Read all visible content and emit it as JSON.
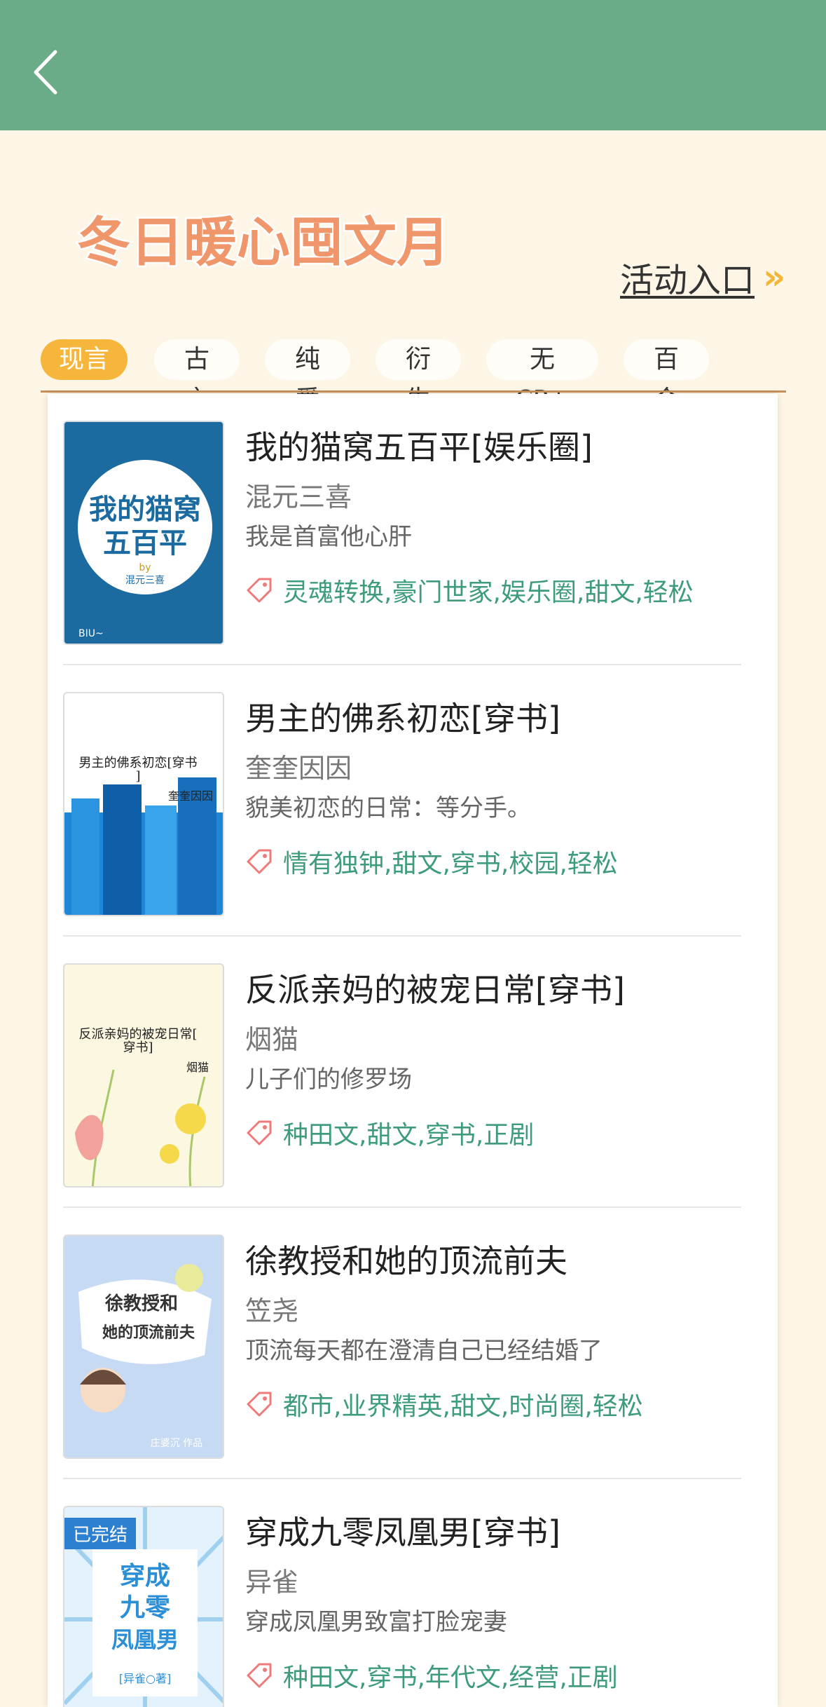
{
  "header": {
    "title": ""
  },
  "banner": {
    "text": "冬日暖心囤文月"
  },
  "entry": {
    "label": "活动入口",
    "chevron": "»"
  },
  "tabs": [
    {
      "label": "现言",
      "active": true
    },
    {
      "label": "古言",
      "active": false
    },
    {
      "label": "纯爱",
      "active": false
    },
    {
      "label": "衍生",
      "active": false
    },
    {
      "label": "无CP+",
      "active": false
    },
    {
      "label": "百合",
      "active": false
    }
  ],
  "books": [
    {
      "title": "我的猫窝五百平[娱乐圈]",
      "author": "混元三喜",
      "desc": "我是首富他心肝",
      "tags": "灵魂转换,豪门世家,娱乐圈,甜文,轻松",
      "cover": {
        "line1": "我的猫窝",
        "line2": "五百平",
        "by": "by",
        "author": "混元三喜",
        "brand": "BIU~"
      }
    },
    {
      "title": "男主的佛系初恋[穿书]",
      "author": "奎奎因因",
      "desc": "貌美初恋的日常：等分手。",
      "tags": "情有独钟,甜文,穿书,校园,轻松",
      "cover": {
        "line1": "男主的佛系初恋[穿书",
        "line2": "]",
        "author": "奎奎因因"
      }
    },
    {
      "title": "反派亲妈的被宠日常[穿书]",
      "author": "烟猫",
      "desc": "儿子们的修罗场",
      "tags": "种田文,甜文,穿书,正剧",
      "cover": {
        "line1": "反派亲妈的被宠日常[",
        "line2": "穿书]",
        "author": "烟猫"
      }
    },
    {
      "title": "徐教授和她的顶流前夫",
      "author": "笠尧",
      "desc": "顶流每天都在澄清自己已经结婚了",
      "tags": "都市,业界精英,甜文,时尚圈,轻松",
      "cover": {
        "line1": "徐教授和",
        "line2": "她的顶流前夫",
        "author": "庄婆沉 作品"
      }
    },
    {
      "title": "穿成九零凤凰男[穿书]",
      "author": "异雀",
      "desc": "穿成凤凰男致富打脸宠妻",
      "tags": "种田文,穿书,年代文,经营,正剧",
      "cover": {
        "badge": "已完结",
        "line1": "穿成",
        "line2": "九零",
        "line3": "凤凰男",
        "author": "[异雀○著]"
      }
    }
  ],
  "colors": {
    "header": "#6aab88",
    "accent": "#f6b63c",
    "tag": "#3e9c7c",
    "background": "#fdf6e6"
  }
}
